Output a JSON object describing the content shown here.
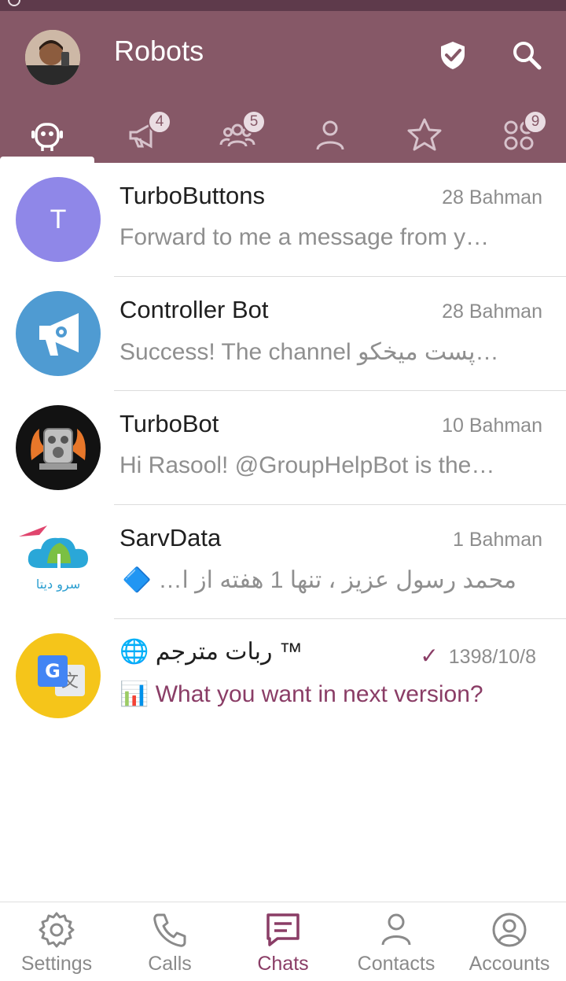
{
  "header": {
    "title": "Robots"
  },
  "tabs": [
    {
      "icon": "robot-icon",
      "badge": ""
    },
    {
      "icon": "megaphone-icon",
      "badge": "4"
    },
    {
      "icon": "group-icon",
      "badge": "5"
    },
    {
      "icon": "person-icon",
      "badge": ""
    },
    {
      "icon": "star-icon",
      "badge": ""
    },
    {
      "icon": "grid-icon",
      "badge": "9"
    }
  ],
  "chats": [
    {
      "name": "TurboButtons",
      "date": "28 Bahman",
      "preview": "Forward to me a message from y…",
      "avatar_letter": "T"
    },
    {
      "name": "Controller Bot",
      "date": "28 Bahman",
      "preview": "Success! The channel پست میخکو…"
    },
    {
      "name": "TurboBot",
      "date": "10 Bahman",
      "preview": "Hi Rasool!  @GroupHelpBot is the…"
    },
    {
      "name": "SarvData",
      "date": "1 Bahman",
      "preview": "محمد رسول عزیز ، تنها 1 هفته از ا… 🔷",
      "logo_text": "سرو دیتا"
    },
    {
      "name": "ربات مترجم ™",
      "date": "1398/10/8",
      "preview": "What you want in next version?",
      "name_emoji": "🌐",
      "preview_emoji": "📊"
    }
  ],
  "bottomnav": {
    "settings": "Settings",
    "calls": "Calls",
    "chats": "Chats",
    "contacts": "Contacts",
    "accounts": "Accounts"
  },
  "colors": {
    "header": "#865867",
    "accent": "#8a3d66"
  }
}
